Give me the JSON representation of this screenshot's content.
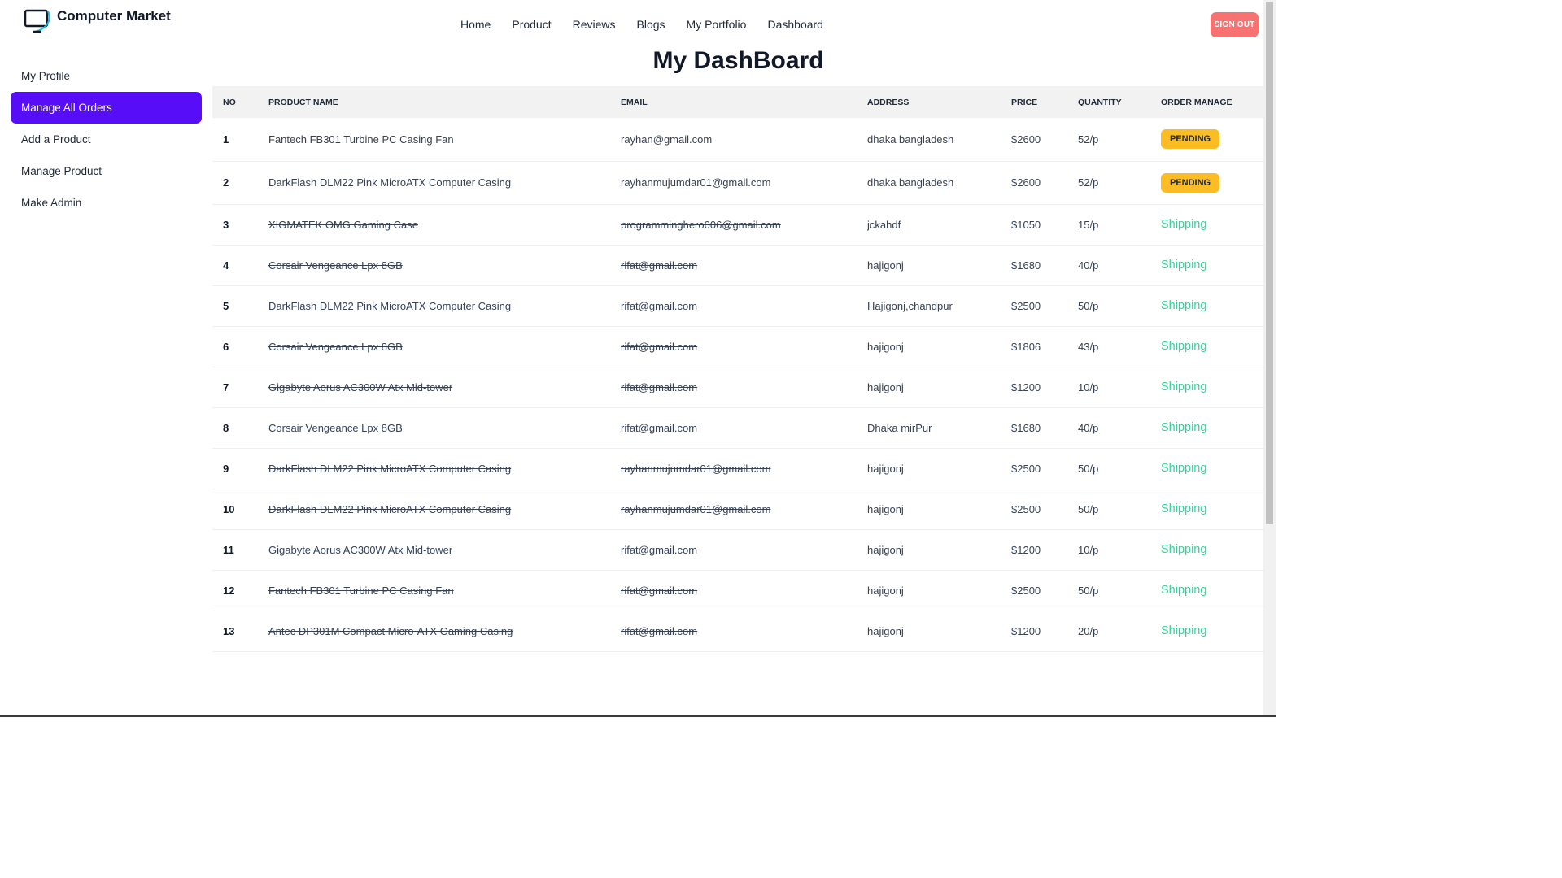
{
  "brand": {
    "name": "Computer Market",
    "icon": "computer-monitor-icon"
  },
  "nav": [
    "Home",
    "Product",
    "Reviews",
    "Blogs",
    "My Portfolio",
    "Dashboard"
  ],
  "signout_label": "SIGN OUT",
  "title": "My DashBoard",
  "sidebar": [
    {
      "label": "My Profile",
      "active": false
    },
    {
      "label": "Manage All Orders",
      "active": true
    },
    {
      "label": "Add a Product",
      "active": false
    },
    {
      "label": "Manage Product",
      "active": false
    },
    {
      "label": "Make Admin",
      "active": false
    }
  ],
  "table": {
    "headers": [
      "NO",
      "PRODUCT NAME",
      "EMAIL",
      "ADDRESS",
      "PRICE",
      "QUANTITY",
      "ORDER MANAGE"
    ],
    "rows": [
      {
        "no": "1",
        "product": "Fantech FB301 Turbine PC Casing Fan",
        "email": "rayhan@gmail.com",
        "address": "dhaka bangladesh",
        "price": "$2600",
        "quantity": "52/p",
        "status": "PENDING",
        "struck": false
      },
      {
        "no": "2",
        "product": "DarkFlash DLM22 Pink MicroATX Computer Casing",
        "email": "rayhanmujumdar01@gmail.com",
        "address": "dhaka bangladesh",
        "price": "$2600",
        "quantity": "52/p",
        "status": "PENDING",
        "struck": false
      },
      {
        "no": "3",
        "product": "XIGMATEK OMG Gaming Case",
        "email": "programminghero006@gmail.com",
        "address": "jckahdf",
        "price": "$1050",
        "quantity": "15/p",
        "status": "Shipping",
        "struck": true
      },
      {
        "no": "4",
        "product": "Corsair Vengeance Lpx 8GB",
        "email": "rifat@gmail.com",
        "address": "hajigonj",
        "price": "$1680",
        "quantity": "40/p",
        "status": "Shipping",
        "struck": true
      },
      {
        "no": "5",
        "product": "DarkFlash DLM22 Pink MicroATX Computer Casing",
        "email": "rifat@gmail.com",
        "address": "Hajigonj,chandpur",
        "price": "$2500",
        "quantity": "50/p",
        "status": "Shipping",
        "struck": true
      },
      {
        "no": "6",
        "product": "Corsair Vengeance Lpx 8GB",
        "email": "rifat@gmail.com",
        "address": "hajigonj",
        "price": "$1806",
        "quantity": "43/p",
        "status": "Shipping",
        "struck": true
      },
      {
        "no": "7",
        "product": "Gigabyte Aorus AC300W Atx Mid-tower",
        "email": "rifat@gmail.com",
        "address": "hajigonj",
        "price": "$1200",
        "quantity": "10/p",
        "status": "Shipping",
        "struck": true
      },
      {
        "no": "8",
        "product": "Corsair Vengeance Lpx 8GB",
        "email": "rifat@gmail.com",
        "address": "Dhaka mirPur",
        "price": "$1680",
        "quantity": "40/p",
        "status": "Shipping",
        "struck": true
      },
      {
        "no": "9",
        "product": "DarkFlash DLM22 Pink MicroATX Computer Casing",
        "email": "rayhanmujumdar01@gmail.com",
        "address": "hajigonj",
        "price": "$2500",
        "quantity": "50/p",
        "status": "Shipping",
        "struck": true
      },
      {
        "no": "10",
        "product": "DarkFlash DLM22 Pink MicroATX Computer Casing",
        "email": "rayhanmujumdar01@gmail.com",
        "address": "hajigonj",
        "price": "$2500",
        "quantity": "50/p",
        "status": "Shipping",
        "struck": true
      },
      {
        "no": "11",
        "product": "Gigabyte Aorus AC300W Atx Mid-tower",
        "email": "rifat@gmail.com",
        "address": "hajigonj",
        "price": "$1200",
        "quantity": "10/p",
        "status": "Shipping",
        "struck": true
      },
      {
        "no": "12",
        "product": "Fantech FB301 Turbine PC Casing Fan",
        "email": "rifat@gmail.com",
        "address": "hajigonj",
        "price": "$2500",
        "quantity": "50/p",
        "status": "Shipping",
        "struck": true
      },
      {
        "no": "13",
        "product": "Antec DP301M Compact Micro-ATX Gaming Casing",
        "email": "rifat@gmail.com",
        "address": "hajigonj",
        "price": "$1200",
        "quantity": "20/p",
        "status": "Shipping",
        "struck": true
      }
    ]
  },
  "colors": {
    "primary": "#570df8",
    "warning": "#fbbd23",
    "success": "#36d399",
    "error": "#f87272"
  }
}
